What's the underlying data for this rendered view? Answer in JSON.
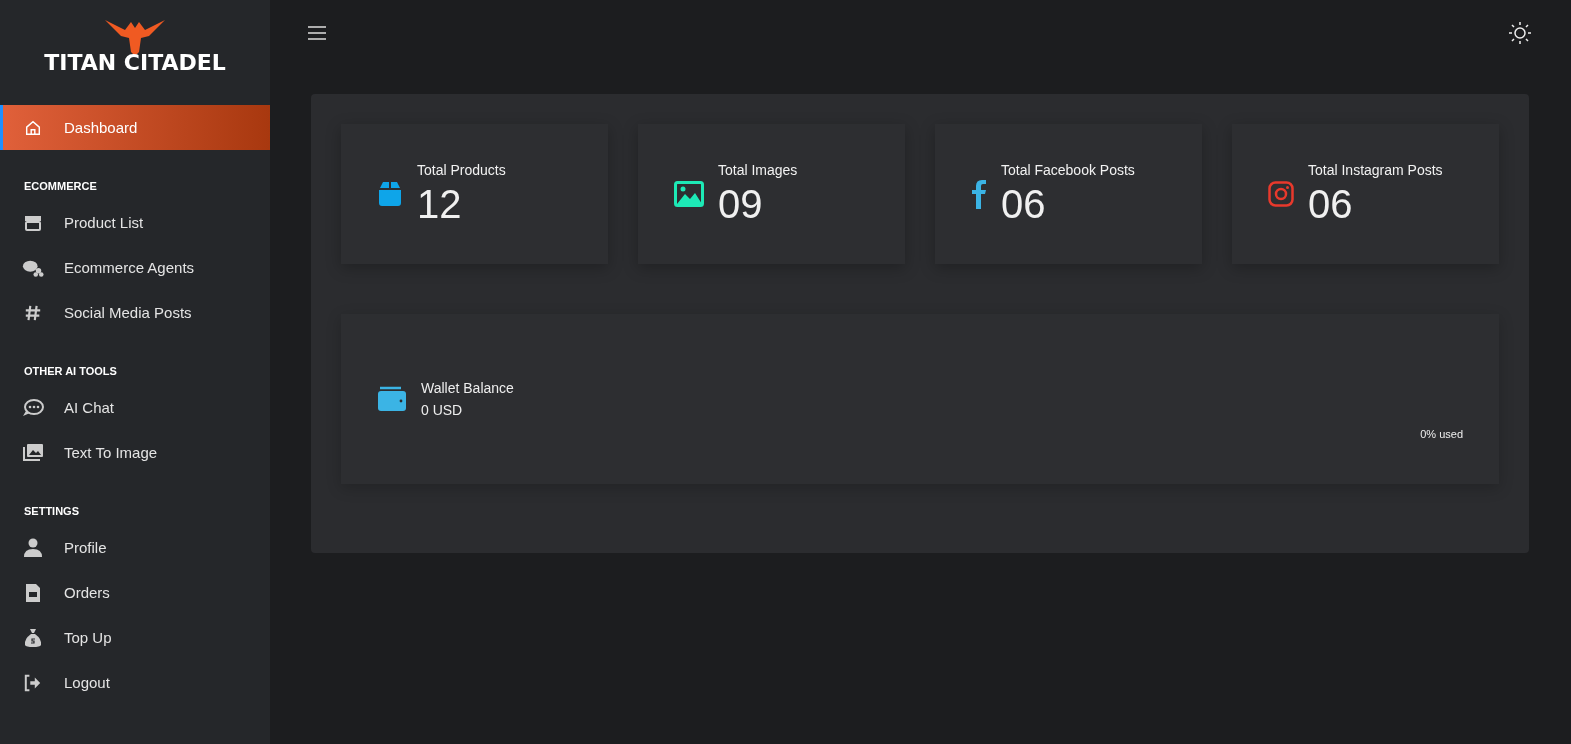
{
  "sidebar": {
    "logo": {
      "text": "TITAN CITADEL"
    },
    "items": [
      {
        "label": "Dashboard",
        "kind": "home",
        "selected": true
      }
    ],
    "sections": [
      {
        "title": "ECOMMERCE",
        "items": [
          {
            "label": "Product List",
            "kind": "store",
            "selected": false
          },
          {
            "label": "Ecommerce Agents",
            "kind": "agents",
            "selected": false
          },
          {
            "label": "Social Media Posts",
            "kind": "hash",
            "selected": false
          }
        ]
      },
      {
        "title": "OTHER AI TOOLS",
        "items": [
          {
            "label": "AI Chat",
            "kind": "chat",
            "selected": false
          },
          {
            "label": "Text To Image",
            "kind": "images",
            "selected": false
          }
        ]
      },
      {
        "title": "SETTINGS",
        "items": [
          {
            "label": "Profile",
            "kind": "user",
            "selected": false
          },
          {
            "label": "Orders",
            "kind": "doc",
            "selected": false
          },
          {
            "label": "Top Up",
            "kind": "money",
            "selected": false
          },
          {
            "label": "Logout",
            "kind": "logout",
            "selected": false
          }
        ]
      }
    ]
  },
  "stats": [
    {
      "label": "Total Products",
      "value": "12",
      "kind": "box",
      "color": "#0ea5e9"
    },
    {
      "label": "Total Images",
      "value": "09",
      "kind": "image",
      "color": "#1de9b6"
    },
    {
      "label": "Total Facebook Posts",
      "value": "06",
      "kind": "facebook",
      "color": "#3bb4e5"
    },
    {
      "label": "Total Instagram Posts",
      "value": "06",
      "kind": "instagram",
      "color": "#e8392c"
    }
  ],
  "wallet": {
    "label": "Wallet Balance",
    "value": "0 USD",
    "usage": "0% used"
  }
}
